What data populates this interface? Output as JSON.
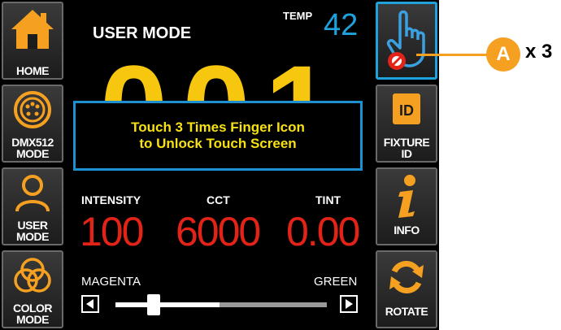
{
  "screen": {
    "title": "USER MODE",
    "temp_label": "TEMP",
    "temp_value": "42",
    "big_number": "001",
    "lock_message": [
      "Touch 3 Times Finger Icon",
      "to Unlock Touch Screen"
    ]
  },
  "left_buttons": [
    {
      "label": "HOME",
      "icon": "home-icon"
    },
    {
      "label": "DMX512 MODE",
      "icon": "dmx-connector-icon"
    },
    {
      "label": "USER MODE",
      "icon": "user-icon"
    },
    {
      "label": "COLOR MODE",
      "icon": "color-circles-icon"
    }
  ],
  "right_buttons": [
    {
      "label": "",
      "icon": "locked-finger-icon"
    },
    {
      "label": "FIXTURE ID",
      "icon": "id-card-icon"
    },
    {
      "label": "INFO",
      "icon": "info-icon"
    },
    {
      "label": "ROTATE",
      "icon": "rotate-icon"
    }
  ],
  "params": [
    {
      "label": "INTENSITY",
      "value": "100"
    },
    {
      "label": "CCT",
      "value": "6000"
    },
    {
      "label": "TINT",
      "value": "0.00"
    }
  ],
  "slider": {
    "left_label": "MAGENTA",
    "right_label": "GREEN",
    "level": 0.18
  },
  "callout": {
    "letter": "A",
    "count": "x 3"
  },
  "colors": {
    "accent": "#1fa2dc",
    "value_red": "#e32318",
    "yellow": "#f7c60f",
    "orange": "#f5a020"
  }
}
